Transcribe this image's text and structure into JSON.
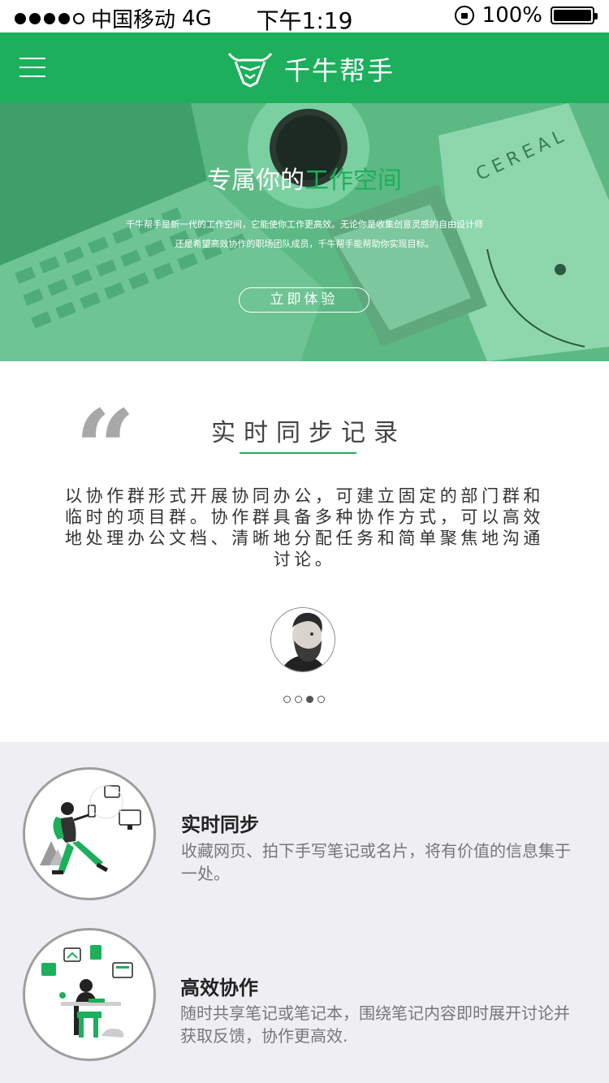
{
  "status_bar": {
    "carrier": "中国移动",
    "network": "4G",
    "time": "下午1:19",
    "battery": "100%"
  },
  "nav": {
    "title": "千牛帮手",
    "menu_icon": "hamburger-menu-icon",
    "logo_icon": "bull-head-logo-icon",
    "accent_color": "#1daf5c"
  },
  "hero": {
    "title_prefix": "专属你的",
    "title_highlight": "工作空间",
    "desc_line1": "千牛帮手是新一代的工作空间，它能使你工作更高效。无论你是收集创意灵感的自由设计师",
    "desc_line2": "还是希望高效协作的职场团队成员，千牛帮手能帮助你实现目标。",
    "cta_label": "立即体验",
    "cereal_text": "CEREAL"
  },
  "testimonial": {
    "title": "实时同步记录",
    "body": "以协作群形式开展协同办公，可建立固定的部门群和临时的项目群。协作群具备多种协作方式，可以高效地处理办公文档、清晰地分配任务和简单聚焦地沟通讨论。",
    "pager_count": 4,
    "pager_active": 3
  },
  "features": [
    {
      "title": "实时同步",
      "desc": "收藏网页、拍下手写笔记或名片，将有价值的信息集于一处。",
      "icon": "walking-person-devices-icon"
    },
    {
      "title": "高效协作",
      "desc": "随时共享笔记或笔记本，围绕笔记内容即时展开讨论并获取反馈，协作更高效.",
      "icon": "person-at-desk-documents-icon"
    }
  ]
}
